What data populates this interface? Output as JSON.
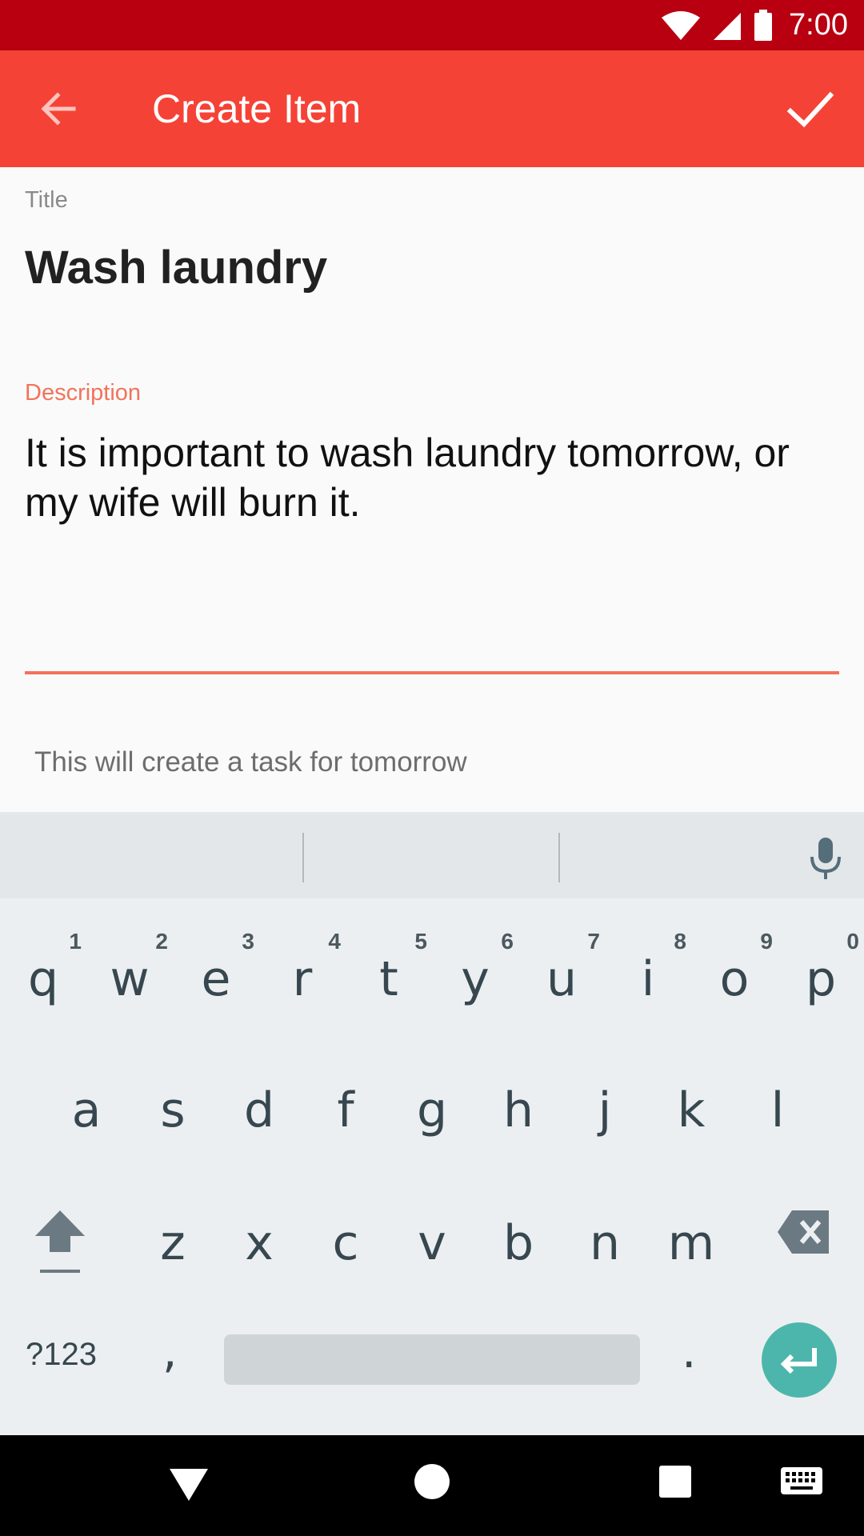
{
  "status_bar": {
    "time": "7:00"
  },
  "app_bar": {
    "title": "Create Item",
    "color": "#f44336"
  },
  "form": {
    "title_label": "Title",
    "title_value": "Wash laundry",
    "description_label": "Description",
    "description_value": "It is important to wash laundry tomorrow, or my wife will burn it.",
    "helper_text": "This will create a task for tomorrow",
    "accent_color": "#f2735a"
  },
  "keyboard": {
    "row1": [
      {
        "ch": "q",
        "num": "1"
      },
      {
        "ch": "w",
        "num": "2"
      },
      {
        "ch": "e",
        "num": "3"
      },
      {
        "ch": "r",
        "num": "4"
      },
      {
        "ch": "t",
        "num": "5"
      },
      {
        "ch": "y",
        "num": "6"
      },
      {
        "ch": "u",
        "num": "7"
      },
      {
        "ch": "i",
        "num": "8"
      },
      {
        "ch": "o",
        "num": "9"
      },
      {
        "ch": "p",
        "num": "0"
      }
    ],
    "row2": [
      "a",
      "s",
      "d",
      "f",
      "g",
      "h",
      "j",
      "k",
      "l"
    ],
    "row3": [
      "z",
      "x",
      "c",
      "v",
      "b",
      "n",
      "m"
    ],
    "symbols_key": "?123",
    "comma_key": ",",
    "period_key": ".",
    "enter_color": "#4db6ac"
  }
}
